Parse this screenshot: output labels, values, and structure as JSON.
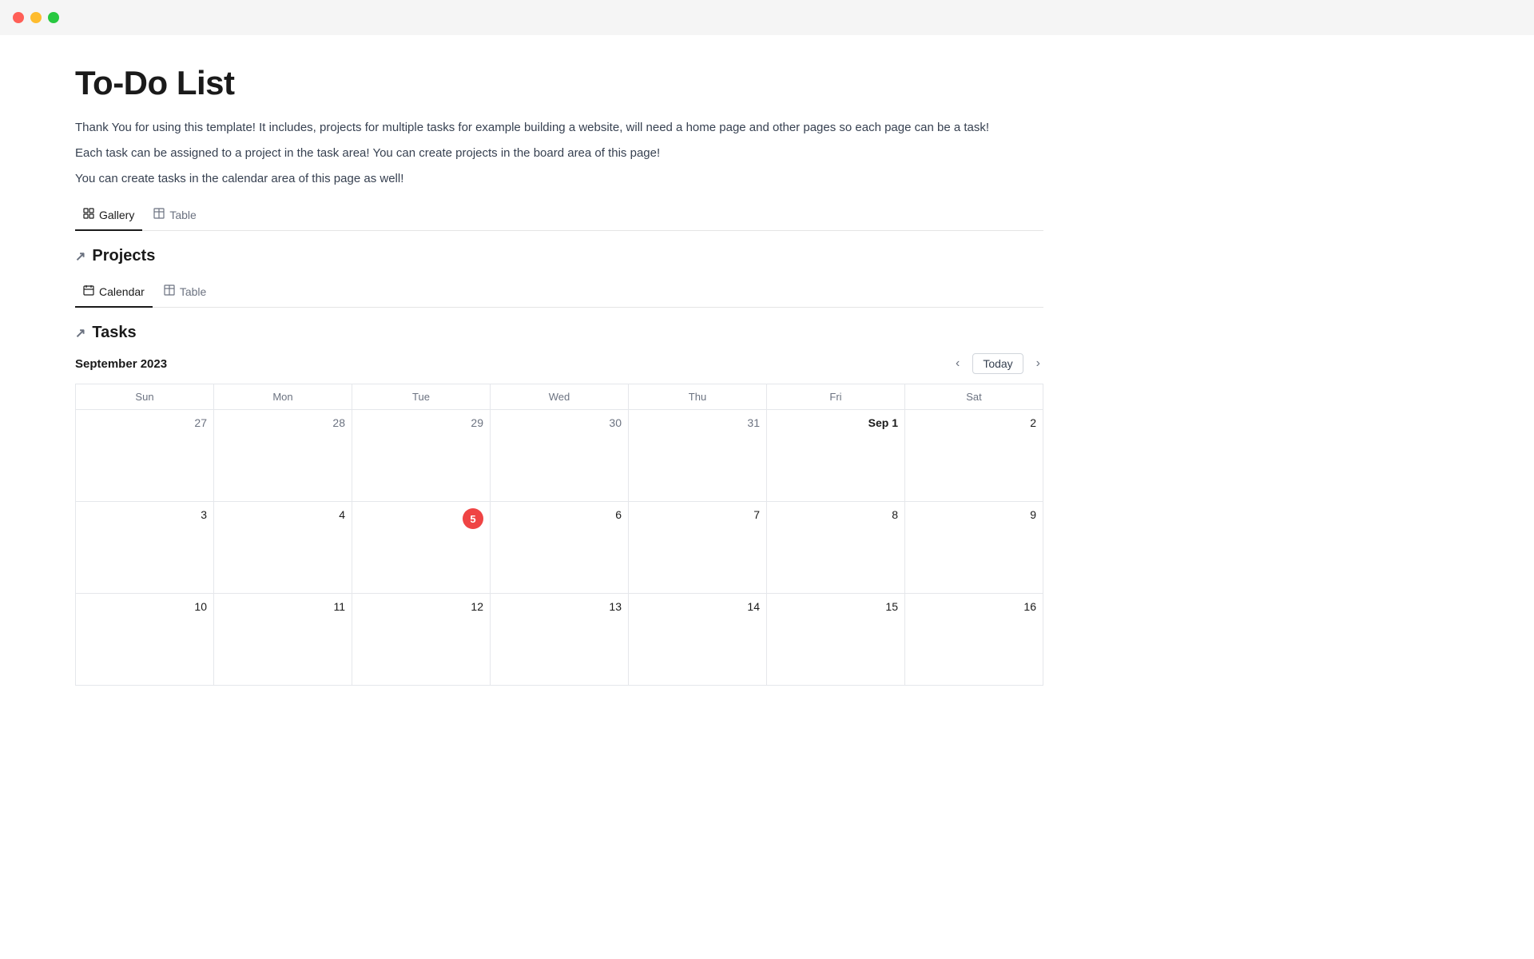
{
  "titlebar": {
    "lights": [
      "red",
      "yellow",
      "green"
    ]
  },
  "page": {
    "title": "To-Do List",
    "description1": "Thank You for using this template! It includes, projects for multiple tasks for example building a website, will need a home page and other pages so each page can be a task!",
    "description2": "Each task can be assigned to a project in the task area! You can create projects in the board area of this page!",
    "description3": "You can create tasks in the calendar area of this page as well!"
  },
  "gallery_tabs": [
    {
      "id": "gallery",
      "label": "Gallery",
      "active": true
    },
    {
      "id": "table",
      "label": "Table",
      "active": false
    }
  ],
  "projects_section": {
    "title": "Projects",
    "tabs": [
      {
        "id": "calendar",
        "label": "Calendar",
        "active": true
      },
      {
        "id": "table",
        "label": "Table",
        "active": false
      }
    ]
  },
  "tasks_section": {
    "title": "Tasks",
    "calendar": {
      "month": "September 2023",
      "today_label": "Today",
      "days_of_week": [
        "Sun",
        "Mon",
        "Tue",
        "Wed",
        "Thu",
        "Fri",
        "Sat"
      ],
      "weeks": [
        [
          {
            "num": "27",
            "current": false
          },
          {
            "num": "28",
            "current": false
          },
          {
            "num": "29",
            "current": false
          },
          {
            "num": "30",
            "current": false
          },
          {
            "num": "31",
            "current": false
          },
          {
            "num": "Sep 1",
            "current": true,
            "bold": true
          },
          {
            "num": "2",
            "current": true
          }
        ],
        [
          {
            "num": "3",
            "current": true
          },
          {
            "num": "4",
            "current": true
          },
          {
            "num": "5",
            "current": true,
            "today": true
          },
          {
            "num": "6",
            "current": true
          },
          {
            "num": "7",
            "current": true
          },
          {
            "num": "8",
            "current": true
          },
          {
            "num": "9",
            "current": true
          }
        ],
        [
          {
            "num": "10",
            "current": true
          },
          {
            "num": "11",
            "current": true
          },
          {
            "num": "12",
            "current": true
          },
          {
            "num": "13",
            "current": true
          },
          {
            "num": "14",
            "current": true
          },
          {
            "num": "15",
            "current": true
          },
          {
            "num": "16",
            "current": true
          }
        ]
      ]
    }
  }
}
